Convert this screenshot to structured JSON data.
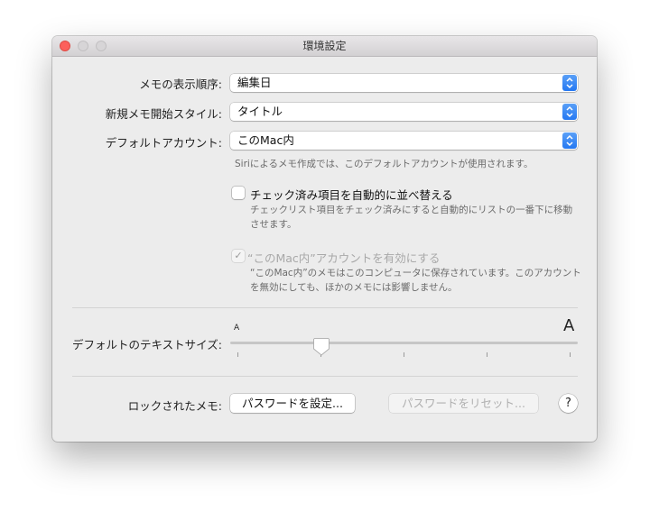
{
  "window": {
    "title": "環境設定"
  },
  "sort": {
    "label": "メモの表示順序:",
    "value": "編集日"
  },
  "new_note_style": {
    "label": "新規メモ開始スタイル:",
    "value": "タイトル"
  },
  "default_account": {
    "label": "デフォルトアカウント:",
    "value": "このMac内",
    "note": "Siriによるメモ作成では、このデフォルトアカウントが使用されます。"
  },
  "sort_checked": {
    "label": "チェック済み項目を自動的に並べ替える",
    "checked": false,
    "note_line1": "チェックリスト項目をチェック済みにすると自動的にリストの一番下に移動",
    "note_line2": "させます。"
  },
  "mac_account": {
    "label": "“このMac内”アカウントを有効にする",
    "checked": true,
    "enabled": false,
    "check_glyph": "✓",
    "note_line1": "“このMac内”のメモはこのコンピュータに保存されています。このアカウント",
    "note_line2": "を無効にしても、ほかのメモには影響しません。"
  },
  "text_size": {
    "label": "デフォルトのテキストサイズ:",
    "small_label": "A",
    "large_label": "A",
    "value_step": 2,
    "steps": 5
  },
  "locked_notes": {
    "label": "ロックされたメモ:",
    "set_password": "パスワードを設定...",
    "reset_password": "パスワードをリセット...",
    "help": "?"
  },
  "colors": {
    "accent": "#2478f2",
    "close": "#fc605c"
  }
}
